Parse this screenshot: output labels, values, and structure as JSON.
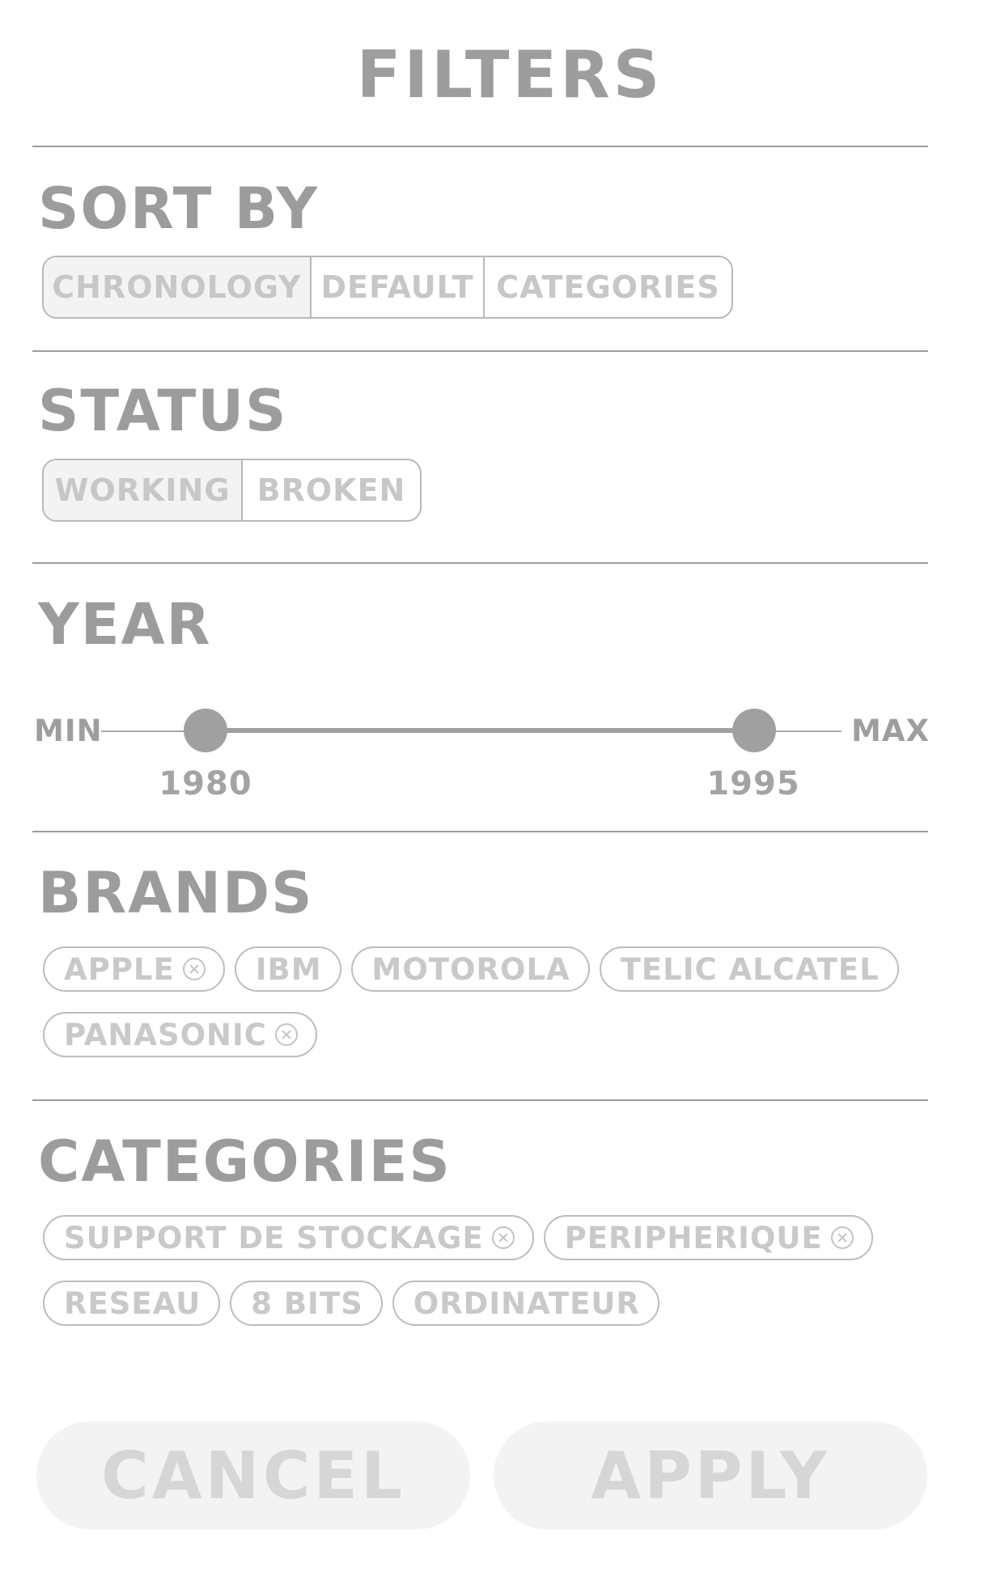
{
  "header": {
    "title": "FILTERS"
  },
  "sort_by": {
    "title": "SORT BY",
    "options": [
      "CHRONOLOGY",
      "DEFAULT",
      "CATEGORIES"
    ],
    "selected": "CHRONOLOGY"
  },
  "status": {
    "title": "STATUS",
    "options": [
      "WORKING",
      "BROKEN"
    ],
    "selected": "WORKING"
  },
  "year": {
    "title": "YEAR",
    "min_label": "MIN",
    "max_label": "MAX",
    "low_value": "1980",
    "high_value": "1995"
  },
  "brands": {
    "title": "BRANDS",
    "chips": [
      {
        "label": "APPLE",
        "selected": true
      },
      {
        "label": "IBM",
        "selected": false
      },
      {
        "label": "MOTOROLA",
        "selected": false
      },
      {
        "label": "TELIC ALCATEL",
        "selected": false
      },
      {
        "label": "PANASONIC",
        "selected": true
      }
    ]
  },
  "categories": {
    "title": "CATEGORIES",
    "chips": [
      {
        "label": "SUPPORT DE STOCKAGE",
        "selected": true
      },
      {
        "label": "PERIPHERIQUE",
        "selected": true
      },
      {
        "label": "RESEAU",
        "selected": false
      },
      {
        "label": "8 BITS",
        "selected": false
      },
      {
        "label": "ORDINATEUR",
        "selected": false
      }
    ]
  },
  "actions": {
    "cancel_label": "CANCEL",
    "apply_label": "APPLY"
  },
  "colors": {
    "text_primary": "#9c9c9c",
    "text_muted": "#c9c9c9",
    "button_bg": "#f3f3f3",
    "button_text": "#d6d6d6"
  }
}
